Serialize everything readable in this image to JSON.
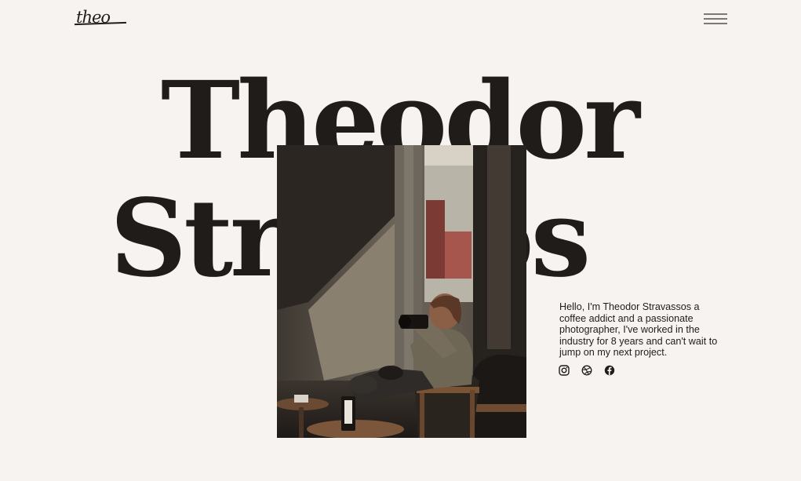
{
  "header": {
    "logo_text": "theo",
    "menu_icon": "hamburger-menu-icon"
  },
  "hero": {
    "first_name": "Theodor",
    "last_name": "Strassos",
    "photo_alt": "Photographer with camera sitting in a cafe chair"
  },
  "intro": {
    "text": "Hello, I'm Theodor Stravassos a coffee addict and a passionate photographer, I've worked in the industry for 8 years and can't wait to jump on my next project."
  },
  "socials": [
    {
      "icon": "instagram-icon"
    },
    {
      "icon": "dribbble-icon"
    },
    {
      "icon": "facebook-icon"
    }
  ],
  "colors": {
    "background": "#f7f3f0",
    "text": "#1f1c1a",
    "menu_lines": "#7b7876"
  }
}
